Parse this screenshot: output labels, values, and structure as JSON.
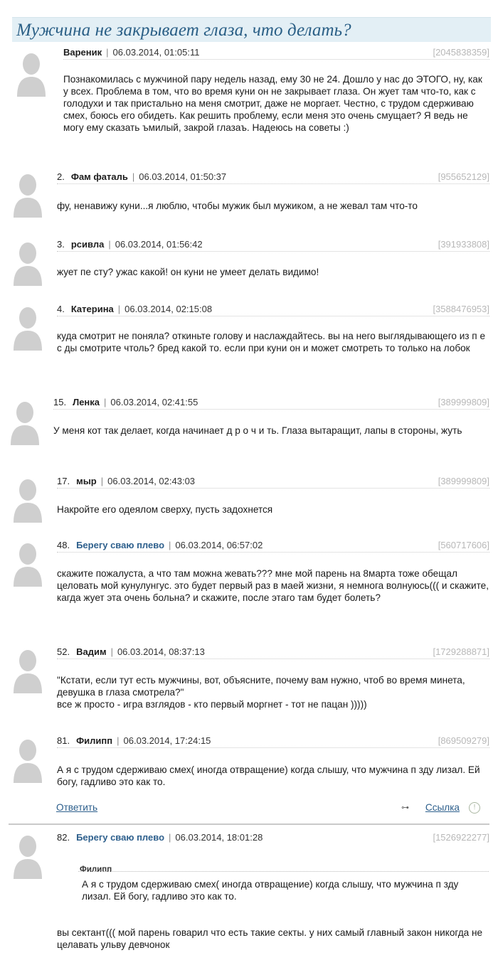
{
  "page": {
    "title": "Мужчина не закрывает глаза, что делать?"
  },
  "posts": [
    {
      "num": "",
      "author": "Вареник",
      "date": "06.03.2014, 01:05:11",
      "uid": "[2045838359]",
      "text": "Познакомилась с мужчиной пару недель назад, ему 30 не 24. Дошло у нас до ЭТОГО, ну, как у всех. Проблема в том, что во время куни он не закрывает глаза. Он жует там что-то, как с голодухи и так пристально на меня смотрит, даже не моргает. Честно, с трудом сдерживаю смех, боюсь его обидеть. Как решить проблему, если меня это очень смущает? Я ведь не могу ему сказать ъмилый, закрой глазаъ. Надеюсь на советы :)"
    },
    {
      "num": "2.",
      "author": "Фам фаталь",
      "date": "06.03.2014, 01:50:37",
      "uid": "[955652129]",
      "text": "фу, ненавижу куни...я люблю, чтобы мужик был мужиком, а не жевал там что-то"
    },
    {
      "num": "3.",
      "author": "рсивла",
      "date": "06.03.2014, 01:56:42",
      "uid": "[391933808]",
      "text": "жует пе сту? ужас какой! он куни не умеет делать видимо!"
    },
    {
      "num": "4.",
      "author": "Катерина",
      "date": "06.03.2014, 02:15:08",
      "uid": "[3588476953]",
      "text": "куда смотрит не поняла? откиньте голову и наслаждайтесь. вы на него выглядывающего из п е с ды смотрите чтоль? бред какой то. если при куни он и может смотреть то только на лобок"
    },
    {
      "num": "15.",
      "author": "Ленка",
      "date": "06.03.2014, 02:41:55",
      "uid": "[389999809]",
      "text": "У меня кот так делает, когда начинает д р о ч и ть. Глаза вытаращит, лапы в стороны, жуть"
    },
    {
      "num": "17.",
      "author": "мыр",
      "date": "06.03.2014, 02:43:03",
      "uid": "[389999809]",
      "text": "Накройте его одеялом сверху, пусть задохнется"
    },
    {
      "num": "48.",
      "author": "Берегу сваю плево",
      "date": "06.03.2014, 06:57:02",
      "uid": "[560717606]",
      "text": "скажите пожалуста, а что там можна жевать??? мне мой парень на 8марта тоже обещал целовать мой кунулунгус. это будет первый раз в маей жизни, я немнога волнуюсь((( и скажите, кагда жует эта очень больна? и скажите, после этаго там будет болеть?"
    },
    {
      "num": "52.",
      "author": "Вадим",
      "date": "06.03.2014, 08:37:13",
      "uid": "[1729288871]",
      "text": "\"Кстати, если тут есть мужчины, вот, объясните, почему вам нужно, чтоб во время минета, девушка в глаза смотрела?\"",
      "text2": "все ж просто - игра взглядов - кто первый моргнет - тот не пацан )))))"
    },
    {
      "num": "81.",
      "author": "Филипп",
      "date": "06.03.2014, 17:24:15",
      "uid": "[869509279]",
      "text": "А я с трудом сдерживаю смех( иногда отвращение) когда слышу, что мужчина п зду лизал. Ей богу, гадливо это как то."
    },
    {
      "num": "82.",
      "author": "Берегу сваю плево",
      "date": "06.03.2014, 18:01:28",
      "uid": "[1526922277]",
      "quote_author": "Филипп",
      "quote_text": "А я с трудом сдерживаю смех( иногда отвращение) когда слышу, что мужчина п зду лизал. Ей богу, гадливо это как то.",
      "text": "вы сектант((( мой парень говарил что есть такие секты. у них самый главный закон никогда не целавать ульву девчонок"
    }
  ],
  "actions": {
    "reply": "Ответить",
    "link": "Ссылка",
    "info": "!"
  },
  "colors": {
    "title": "#2a5f86",
    "title_bg": "#e3eff5",
    "link": "#2d5f8c",
    "uid": "#b8b8b8"
  }
}
